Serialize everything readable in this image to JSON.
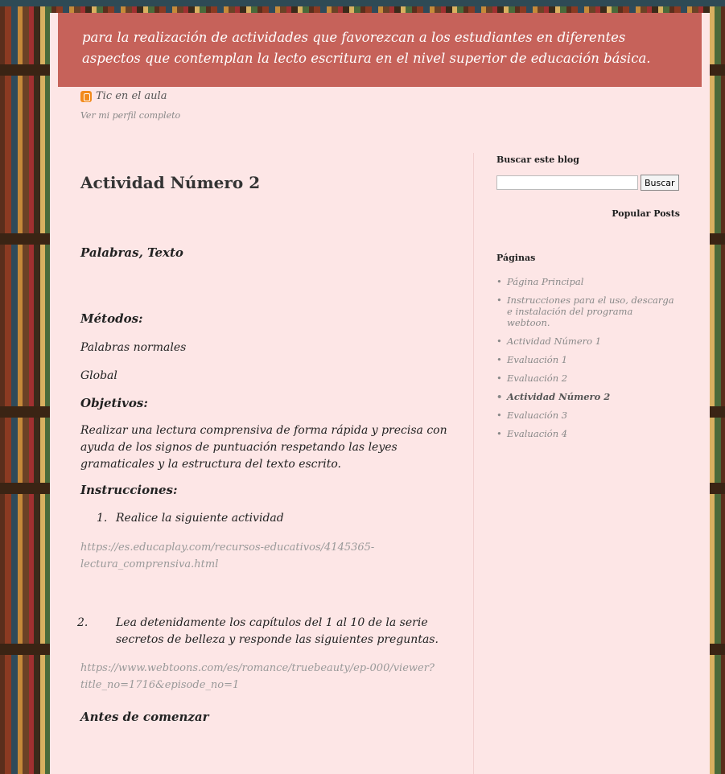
{
  "banner": {
    "description": "para la realización de actividades que favorezcan a los estudiantes en diferentes aspectos que contemplan la lecto escritura en el nivel superior de educación básica."
  },
  "profile": {
    "name": "Tic en el aula",
    "link": "Ver mi perfil completo"
  },
  "post": {
    "title": "Actividad Número 2",
    "subtitle": "Palabras, Texto",
    "methods_heading": "Métodos:",
    "methods": [
      "Palabras normales",
      "Global"
    ],
    "objectives_heading": "Objetivos:",
    "objectives_text": "Realizar una lectura comprensiva de forma rápida y precisa con ayuda de los signos de puntuación respetando las leyes gramaticales y la estructura del texto escrito.",
    "instructions_heading": "Instrucciones:",
    "steps": [
      {
        "num": "1.",
        "text": "Realice la siguiente actividad"
      },
      {
        "num": "2.",
        "text": "Lea detenidamente los capítulos del 1 al 10 de la serie secretos de belleza y responde las siguientes preguntas."
      }
    ],
    "link1": "https://es.educaplay.com/recursos-educativos/4145365-lectura_comprensiva.html",
    "link2": "https://www.webtoons.com/es/romance/truebeauty/ep-000/viewer?title_no=1716&episode_no=1",
    "before_heading": "Antes de comenzar"
  },
  "sidebar": {
    "search_heading": "Buscar este blog",
    "search_value": "",
    "search_button": "Buscar",
    "popular_heading": "Popular Posts",
    "pages_heading": "Páginas",
    "pages": [
      "Página Principal",
      "Instrucciones para el uso, descarga e instalación del programa webtoon.",
      "Actividad Número 1",
      "Evaluación 1",
      "Evaluación 2",
      "Actividad Número 2",
      "Evaluación 3",
      "Evaluación 4"
    ],
    "current_page": "Actividad Número 2"
  },
  "colors": {
    "banner": "#c6625a",
    "page_background": "#fde6e6",
    "top_bar": "#2e4a55"
  }
}
